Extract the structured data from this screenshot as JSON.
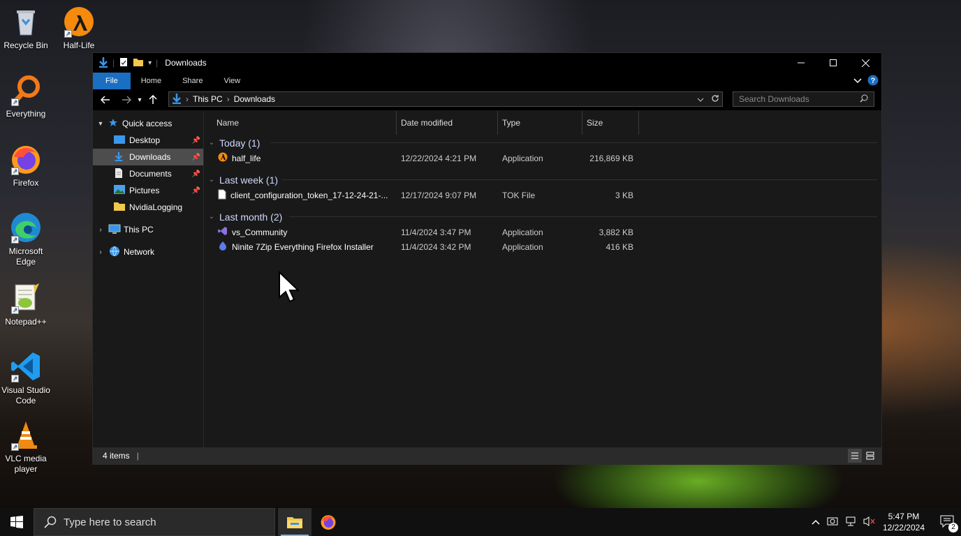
{
  "desktop": {
    "icons": [
      {
        "label": "Recycle Bin"
      },
      {
        "label": "Half-Life"
      },
      {
        "label": "Everything"
      },
      {
        "label": "Firefox"
      },
      {
        "label": "Microsoft Edge"
      },
      {
        "label": "Notepad++"
      },
      {
        "label": "Visual Studio Code"
      },
      {
        "label": "VLC media player"
      }
    ]
  },
  "window": {
    "title": "Downloads",
    "ribbon_tabs": [
      "File",
      "Home",
      "Share",
      "View"
    ],
    "breadcrumb": [
      "This PC",
      "Downloads"
    ],
    "search_placeholder": "Search Downloads",
    "nav": {
      "quick_access": "Quick access",
      "items": [
        "Desktop",
        "Downloads",
        "Documents",
        "Pictures",
        "NvidiaLogging"
      ],
      "this_pc": "This PC",
      "network": "Network"
    },
    "columns": [
      "Name",
      "Date modified",
      "Type",
      "Size"
    ],
    "groups": [
      {
        "label": "Today (1)",
        "files": [
          {
            "name": "half_life",
            "date": "12/22/2024 4:21 PM",
            "type": "Application",
            "size": "216,869 KB",
            "icon": "half-life-icon"
          }
        ]
      },
      {
        "label": "Last week (1)",
        "files": [
          {
            "name": "client_configuration_token_17-12-24-21-...",
            "date": "12/17/2024 9:07 PM",
            "type": "TOK File",
            "size": "3 KB",
            "icon": "file-icon"
          }
        ]
      },
      {
        "label": "Last month (2)",
        "files": [
          {
            "name": "vs_Community",
            "date": "11/4/2024 3:47 PM",
            "type": "Application",
            "size": "3,882 KB",
            "icon": "visual-studio-icon"
          },
          {
            "name": "Ninite 7Zip Everything Firefox Installer",
            "date": "11/4/2024 3:42 PM",
            "type": "Application",
            "size": "416 KB",
            "icon": "ninite-icon"
          }
        ]
      }
    ],
    "status": "4 items"
  },
  "taskbar": {
    "search_placeholder": "Type here to search",
    "time": "5:47 PM",
    "date": "12/22/2024",
    "notification_count": "2"
  },
  "colors": {
    "accent": "#1a6fc2",
    "selected_nav": "#4d4d4d",
    "window_bg": "#191919"
  }
}
